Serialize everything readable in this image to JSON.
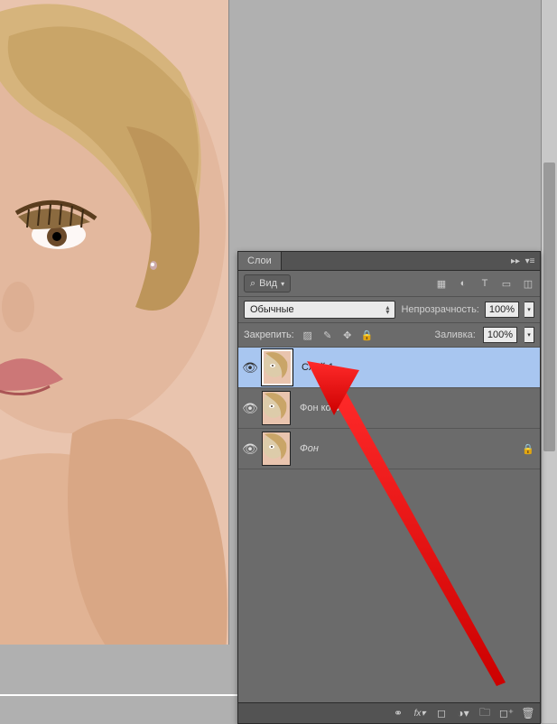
{
  "panel": {
    "title": "Слои",
    "filter": {
      "label": "Вид",
      "icon_tips": [
        "image-filter",
        "adjust-filter",
        "text-filter",
        "shape-filter",
        "smart-filter"
      ]
    },
    "blend": {
      "mode": "Обычные",
      "opacity_label": "Непрозрачность:",
      "opacity_value": "100%"
    },
    "lock": {
      "label": "Закрепить:",
      "fill_label": "Заливка:",
      "fill_value": "100%"
    },
    "layers": [
      {
        "name": "Слой 1",
        "selected": true,
        "locked": false,
        "italic": false
      },
      {
        "name": "Фон копия",
        "selected": false,
        "locked": false,
        "italic": false
      },
      {
        "name": "Фон",
        "selected": false,
        "locked": true,
        "italic": true
      }
    ],
    "footer_icons": [
      "link",
      "fx",
      "mask",
      "adjustment",
      "group",
      "new",
      "delete"
    ]
  }
}
